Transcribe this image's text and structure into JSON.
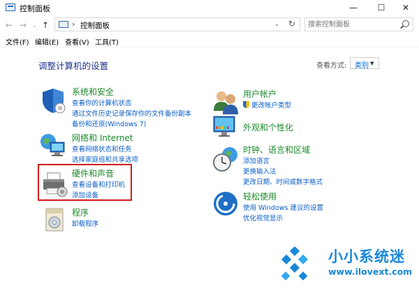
{
  "window": {
    "title": "控制面板",
    "min": "—",
    "max": "☐",
    "close": "✕"
  },
  "nav": {
    "back": "←",
    "forward": "→",
    "dropdown": "⌄",
    "up": "↑"
  },
  "address": {
    "separator": "›",
    "path": "控制面板",
    "refresh": "↻"
  },
  "search": {
    "placeholder": "搜索控制面板"
  },
  "menu": [
    "文件(F)",
    "编辑(E)",
    "查看(V)",
    "工具(T)"
  ],
  "main": {
    "title": "调整计算机的设置",
    "view_label": "查看方式:",
    "view_value": "类别"
  },
  "categories": {
    "system": {
      "title": "系统和安全",
      "links": [
        "查看你的计算机状态",
        "通过文件历史记录保存你的文件备份副本",
        "备份和还原(Windows 7)"
      ]
    },
    "network": {
      "title": "网络和 Internet",
      "links": [
        "查看网络状态和任务",
        "选择家庭组和共享选项"
      ]
    },
    "hardware": {
      "title": "硬件和声音",
      "links": [
        "查看设备和打印机",
        "添加设备"
      ]
    },
    "programs": {
      "title": "程序",
      "links": [
        "卸载程序"
      ]
    },
    "accounts": {
      "title": "用户帐户",
      "links": [
        "更改帐户类型"
      ]
    },
    "appearance": {
      "title": "外观和个性化",
      "links": []
    },
    "clock": {
      "title": "时钟、语言和区域",
      "links": [
        "添加语言",
        "更换输入法",
        "更改日期、时间或数字格式"
      ]
    },
    "ease": {
      "title": "轻松使用",
      "links": [
        "使用 Windows 建议的设置",
        "优化视觉显示"
      ]
    }
  },
  "watermark": {
    "text": "小小系统迷",
    "url": "www.ilovext.com"
  },
  "colors": {
    "category_title": "#1a8a2a",
    "link": "#0b5ec9",
    "heading": "#1e3287",
    "highlight": "#d11a1a",
    "watermark": "#1a88d8"
  }
}
